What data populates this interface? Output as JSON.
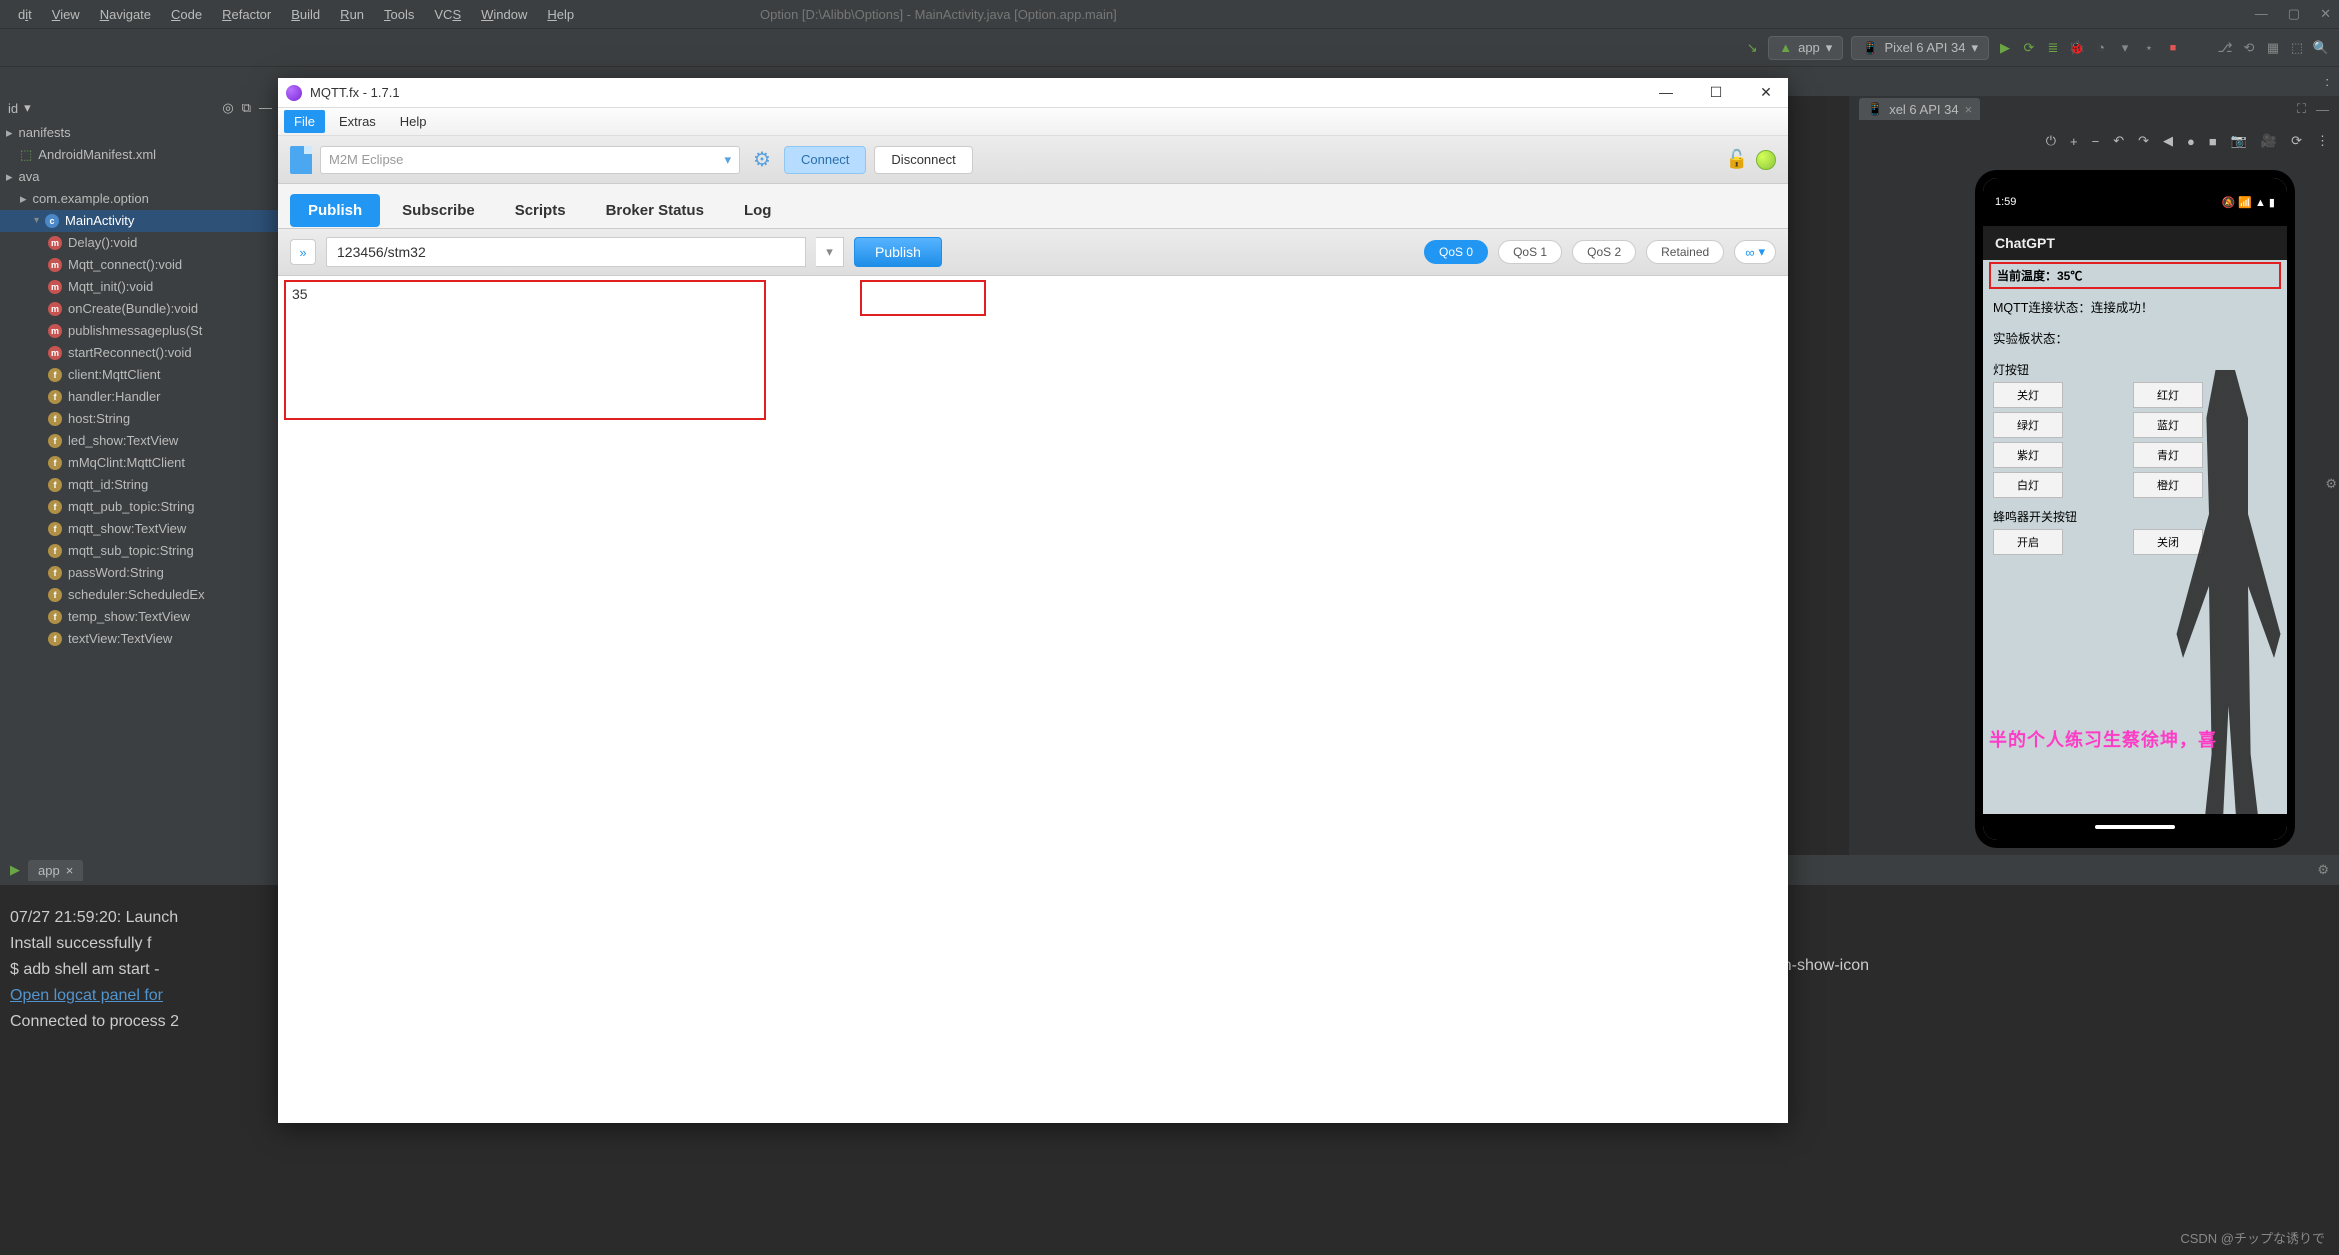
{
  "ide": {
    "menu": [
      "dit",
      "View",
      "Navigate",
      "Code",
      "Refactor",
      "Build",
      "Run",
      "Tools",
      "VCS",
      "Window",
      "Help"
    ],
    "menu_underline": [
      "d",
      "V",
      "N",
      "C",
      "R",
      "B",
      "R",
      "T",
      "",
      "W",
      "H"
    ],
    "title_path": "Option [D:\\Alibb\\Options] - MainActivity.java [Option.app.main]",
    "run_config": "app",
    "device": "Pixel 6 API 34",
    "editor_tab": "xel 6 API 34",
    "structure_header": "id",
    "tree": [
      {
        "label": "nanifests",
        "icon": "folder",
        "indent": 0
      },
      {
        "label": "AndroidManifest.xml",
        "icon": "xml",
        "indent": 1
      },
      {
        "label": "ava",
        "icon": "folder",
        "indent": 0
      },
      {
        "label": "com.example.option",
        "icon": "pkg",
        "indent": 1
      },
      {
        "label": "MainActivity",
        "icon": "class",
        "indent": 2,
        "selected": true,
        "caret": "▾"
      },
      {
        "label": "Delay():void",
        "icon": "m",
        "indent": 3
      },
      {
        "label": "Mqtt_connect():void",
        "icon": "m",
        "indent": 3
      },
      {
        "label": "Mqtt_init():void",
        "icon": "m",
        "indent": 3
      },
      {
        "label": "onCreate(Bundle):void",
        "icon": "m",
        "indent": 3
      },
      {
        "label": "publishmessageplus(St",
        "icon": "m",
        "indent": 3
      },
      {
        "label": "startReconnect():void",
        "icon": "m",
        "indent": 3
      },
      {
        "label": "client:MqttClient",
        "icon": "f",
        "indent": 3
      },
      {
        "label": "handler:Handler",
        "icon": "f",
        "indent": 3
      },
      {
        "label": "host:String",
        "icon": "f",
        "indent": 3
      },
      {
        "label": "led_show:TextView",
        "icon": "f",
        "indent": 3
      },
      {
        "label": "mMqClint:MqttClient",
        "icon": "f",
        "indent": 3
      },
      {
        "label": "mqtt_id:String",
        "icon": "f",
        "indent": 3
      },
      {
        "label": "mqtt_pub_topic:String",
        "icon": "f",
        "indent": 3
      },
      {
        "label": "mqtt_show:TextView",
        "icon": "f",
        "indent": 3
      },
      {
        "label": "mqtt_sub_topic:String",
        "icon": "f",
        "indent": 3
      },
      {
        "label": "passWord:String",
        "icon": "f",
        "indent": 3
      },
      {
        "label": "scheduler:ScheduledEx",
        "icon": "f",
        "indent": 3
      },
      {
        "label": "temp_show:TextView",
        "icon": "f",
        "indent": 3
      },
      {
        "label": "textView:TextView",
        "icon": "f",
        "indent": 3
      }
    ],
    "console_tab": "app",
    "console": [
      "07/27 21:59:20: Launch",
      "Install successfully f",
      "$ adb shell am start -",
      "Open logcat panel for ",
      "Connected to process 2"
    ],
    "console_tail": "ashscreen-show-icon"
  },
  "mqtt": {
    "title": "MQTT.fx - 1.7.1",
    "menu": [
      "File",
      "Extras",
      "Help"
    ],
    "menu_active": "File",
    "profile": "M2M Eclipse",
    "connect": "Connect",
    "disconnect": "Disconnect",
    "tabs": [
      "Publish",
      "Subscribe",
      "Scripts",
      "Broker Status",
      "Log"
    ],
    "active_tab": "Publish",
    "topic": "123456/stm32",
    "publish_label": "Publish",
    "qos": [
      "QoS 0",
      "QoS 1",
      "QoS 2"
    ],
    "qos_active": 0,
    "retained": "Retained",
    "payload": "35"
  },
  "phone": {
    "time": "1:59",
    "app_title": "ChatGPT",
    "temp_line": "当前温度：35℃",
    "mqtt_status": "MQTT连接状态：连接成功！",
    "board_status": "实验板状态：",
    "light_section": "灯按钮",
    "buzzer_section": "蜂鸣器开关按钮",
    "rows": [
      [
        "关灯",
        "红灯"
      ],
      [
        "绿灯",
        "蓝灯"
      ],
      [
        "紫灯",
        "青灯"
      ],
      [
        "白灯",
        "橙灯"
      ]
    ],
    "buzzer_row": [
      "开启",
      "关闭"
    ],
    "marquee": "半的个人练习生蔡徐坤，喜"
  },
  "watermark": "CSDN @チップな诱りで"
}
